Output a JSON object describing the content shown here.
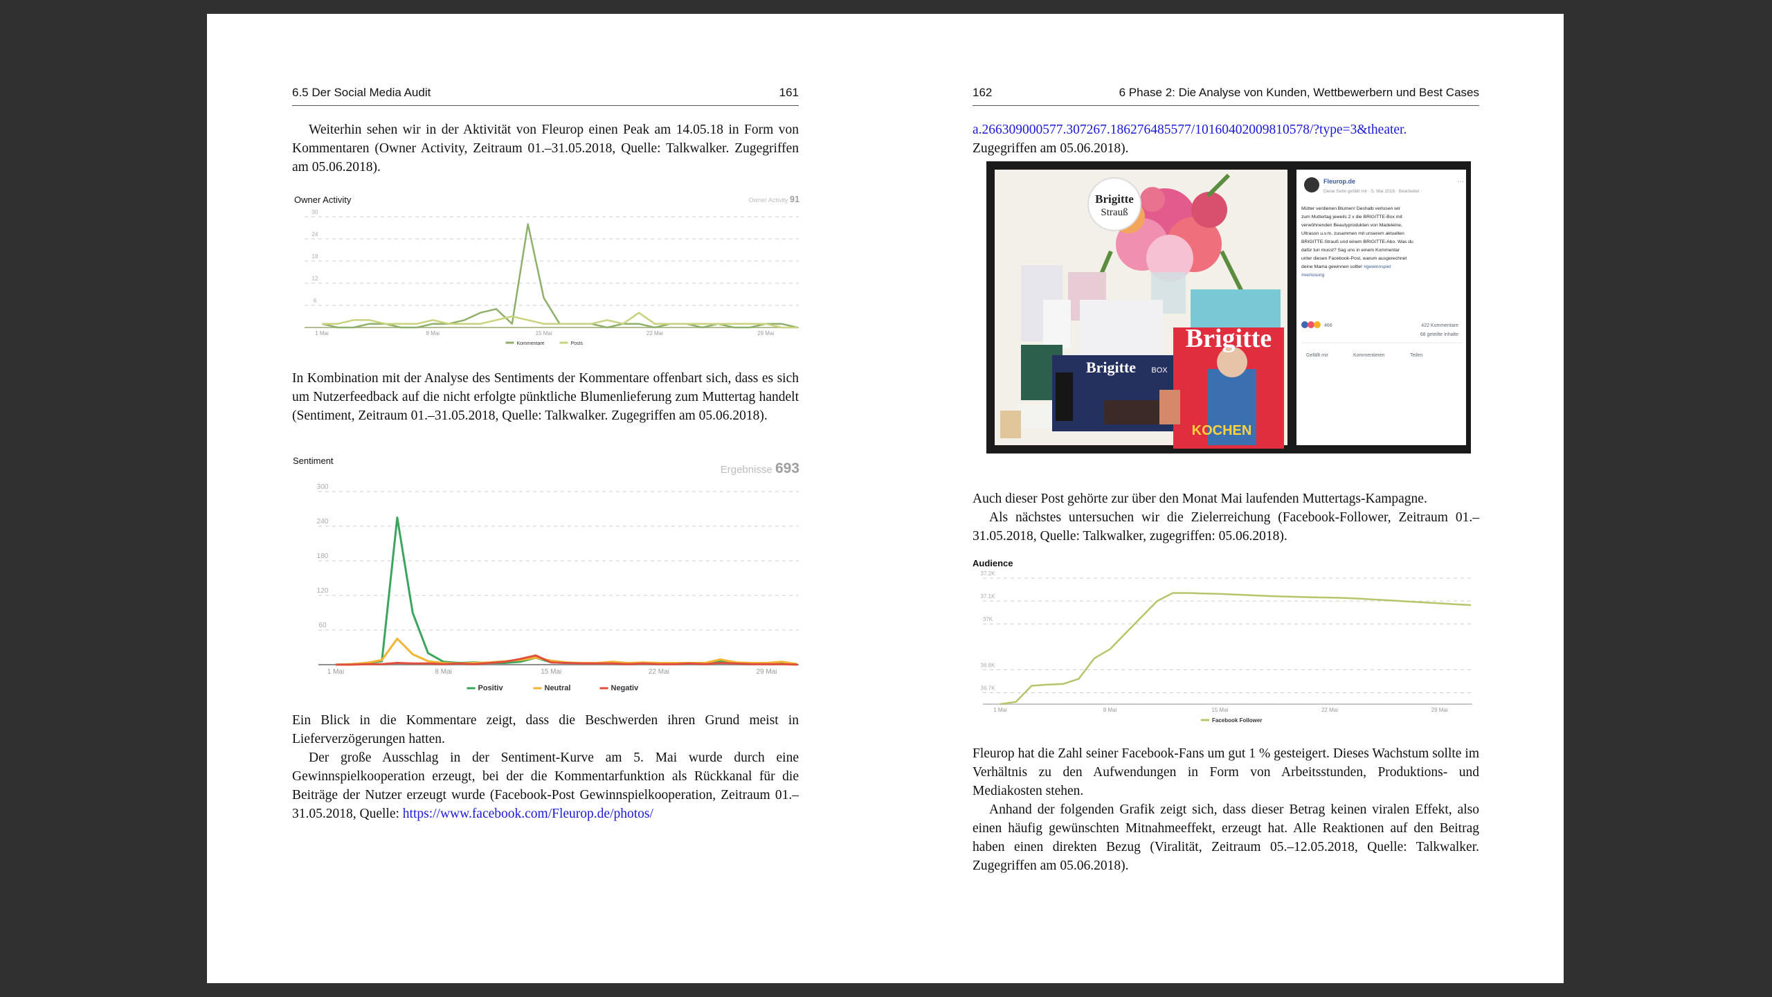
{
  "left_page": {
    "header_section": "6.5   Der Social Media Audit",
    "page_number": "161",
    "para1": "Weiterhin sehen wir in der Aktivität von Fleurop einen Peak am 14.05.18 in Form von Kommentaren (Owner Activity, Zeitraum 01.–31.05.2018, Quelle: Talkwalker. Zugegriffen am 05.06.2018).",
    "para2": "In Kombination mit der Analyse des Sentiments der Kommentare offenbart sich, dass es sich um Nutzerfeedback auf die nicht erfolgte pünktliche Blumenlieferung zum Muttertag handelt (Sentiment, Zeitraum 01.–31.05.2018, Quelle: Talkwalker. Zugegriffen am 05.06.2018).",
    "para3": "Ein Blick in die Kommentare zeigt, dass die Beschwerden ihren Grund meist in Lieferverzögerungen hatten.",
    "para4_text": "Der große Ausschlag in der Sentiment-Kurve am 5. Mai wurde durch eine Gewinnspielkooperation erzeugt, bei der die Kommentarfunktion als Rückkanal für die Beiträge der Nutzer erzeugt wurde (Facebook-Post Gewinnspielkooperation, Zeitraum 01.–31.05.2018, Quelle: ",
    "para4_link": "https://www.facebook.com/Fleurop.de/photos/"
  },
  "right_page": {
    "page_number": "162",
    "header_section": "6   Phase 2: Die Analyse von Kunden, Wettbewerbern und Best Cases",
    "link_cont": "a.266309000577.307267.186276485577/10160402009810578/?type=3&theater.",
    "para_cont": "Zugegriffen am 05.06.2018).",
    "para5": "Auch dieser Post gehörte zur über den Monat Mai laufenden Muttertags-Kampagne.",
    "para6": "Als nächstes untersuchen wir die Zielerreichung (Facebook-Follower, Zeitraum 01.–31.05.2018, Quelle: Talkwalker, zugegriffen: 05.06.2018).",
    "para7": "Fleurop hat die Zahl seiner Facebook-Fans um gut 1 % gesteigert. Dieses Wachstum sollte im Verhältnis zu den Aufwendungen in Form von Arbeitsstunden, Produktions- und Mediakosten stehen.",
    "para8": "Anhand der folgenden Grafik zeigt sich, dass dieser Betrag keinen viralen Effekt, also einen häufig gewünschten Mitnahmeeffekt, erzeugt hat. Alle Reaktionen auf den Beitrag haben einen direkten Bezug (Viralität, Zeitraum 05.–12.05.2018, Quelle: Talkwalker. Zugegriffen am 05.06.2018)."
  },
  "facebook_post": {
    "page_name": "Fleurop.de",
    "meta": "Diese Seite gefällt mir · 5. Mai 2018 · Bearbeitet ·",
    "text": "Mütter verdienen Blumen! Deshalb verlosen wir zum Muttertag jeweils 2 x die BRIGITTE-Box mit verwöhnenden Beautyprodukten von Madeleine, Ultrason u.v.m. zusammen mit unserem aktuellen BRIGITTE-Strauß und einem BRIGITTE-Abo. Was du dafür tun musst? Sag uns in einem Kommentar unter diesen Facebook-Post, warum ausgerechnet deine Mama gewinnen sollte! #gewinnspiel #verlosung",
    "reactions": "466",
    "comments": "422 Kommentare",
    "shares": "68 geteilte Inhalte",
    "like_label": "Gefällt mir",
    "comment_label": "Kommentieren",
    "share_label": "Teilen",
    "badge_line1": "Brigitte",
    "badge_line2": "Strauß",
    "mag_title": "Brigitte",
    "mag_cover_text": "KOCHEN",
    "box_label": "Brigitte",
    "box_sub": "BOX"
  },
  "chart_data": [
    {
      "type": "line",
      "title": "Owner Activity",
      "header_label": "Owner Activity",
      "header_value": "91",
      "x": [
        "1 Mai",
        "2",
        "3",
        "4",
        "5",
        "6",
        "7",
        "8",
        "9",
        "10",
        "11",
        "12",
        "13",
        "14",
        "15",
        "16",
        "17",
        "18",
        "19",
        "20",
        "21",
        "22",
        "23",
        "24",
        "25",
        "26",
        "27",
        "28",
        "29",
        "30",
        "31"
      ],
      "xticks": [
        "1 Mai",
        "8 Mai",
        "15 Mai",
        "22 Mai",
        "29 Mai"
      ],
      "yticks": [
        6,
        12,
        18,
        24,
        30
      ],
      "ylim": [
        0,
        30
      ],
      "series": [
        {
          "name": "Kommentare",
          "color": "#8fb06a",
          "values": [
            1,
            0,
            0,
            1,
            1,
            0,
            0,
            1,
            1,
            2,
            4,
            5,
            1,
            28,
            8,
            1,
            1,
            1,
            0,
            1,
            1,
            0,
            1,
            1,
            0,
            1,
            0,
            0,
            1,
            1,
            0
          ]
        },
        {
          "name": "Posts",
          "color": "#c9d27c",
          "values": [
            1,
            1,
            2,
            2,
            1,
            1,
            1,
            2,
            1,
            1,
            1,
            2,
            3,
            2,
            1,
            1,
            1,
            1,
            2,
            1,
            4,
            1,
            1,
            1,
            1,
            1,
            1,
            1,
            1,
            0,
            0
          ]
        }
      ]
    },
    {
      "type": "line",
      "title": "Sentiment",
      "header_label": "Ergebnisse",
      "header_value": "693",
      "x": [
        "1 Mai",
        "2",
        "3",
        "4",
        "5",
        "6",
        "7",
        "8",
        "9",
        "10",
        "11",
        "12",
        "13",
        "14",
        "15",
        "16",
        "17",
        "18",
        "19",
        "20",
        "21",
        "22",
        "23",
        "24",
        "25",
        "26",
        "27",
        "28",
        "29",
        "30",
        "31"
      ],
      "xticks": [
        "1 Mai",
        "8 Mai",
        "15 Mai",
        "22 Mai",
        "29 Mai"
      ],
      "yticks": [
        60,
        120,
        180,
        240,
        300
      ],
      "ylim": [
        0,
        300
      ],
      "series": [
        {
          "name": "Positiv",
          "color": "#3ba55d",
          "values": [
            0,
            1,
            3,
            6,
            255,
            90,
            20,
            5,
            3,
            4,
            3,
            3,
            5,
            12,
            4,
            3,
            3,
            2,
            4,
            2,
            3,
            3,
            2,
            3,
            2,
            6,
            3,
            2,
            2,
            4,
            1
          ]
        },
        {
          "name": "Neutral",
          "color": "#f2b531",
          "values": [
            0,
            1,
            3,
            8,
            45,
            18,
            6,
            3,
            2,
            3,
            4,
            6,
            8,
            12,
            7,
            4,
            3,
            3,
            5,
            3,
            4,
            3,
            3,
            3,
            3,
            9,
            4,
            3,
            3,
            5,
            1
          ]
        },
        {
          "name": "Negativ",
          "color": "#e04f3d",
          "values": [
            0,
            0,
            1,
            1,
            3,
            2,
            2,
            1,
            2,
            1,
            3,
            5,
            10,
            16,
            4,
            3,
            2,
            2,
            2,
            1,
            2,
            1,
            1,
            2,
            1,
            3,
            2,
            1,
            1,
            1,
            0
          ]
        }
      ]
    },
    {
      "type": "line",
      "title": "Audience",
      "x": [
        "1 Mai",
        "2",
        "3",
        "4",
        "5",
        "6",
        "7",
        "8",
        "9",
        "10",
        "11",
        "12",
        "13",
        "14",
        "15",
        "16",
        "17",
        "18",
        "19",
        "20",
        "21",
        "22",
        "23",
        "24",
        "25",
        "26",
        "27",
        "28",
        "29",
        "30",
        "31"
      ],
      "xticks": [
        "1 Mai",
        "8 Mai",
        "15 Mai",
        "22 Mai",
        "29 Mai"
      ],
      "yticks": [
        "36.7K",
        "36.8K",
        "37K",
        "37.1K",
        "37.2K"
      ],
      "ylim": [
        36650,
        37200
      ],
      "series": [
        {
          "name": "Facebook Follower",
          "color": "#b8c46a",
          "values": [
            36650,
            36660,
            36730,
            36735,
            36738,
            36760,
            36850,
            36890,
            36960,
            37030,
            37100,
            37135,
            37135,
            37133,
            37131,
            37128,
            37125,
            37122,
            37120,
            37118,
            37116,
            37115,
            37113,
            37110,
            37106,
            37102,
            37098,
            37094,
            37090,
            37086,
            37082
          ]
        }
      ]
    }
  ]
}
